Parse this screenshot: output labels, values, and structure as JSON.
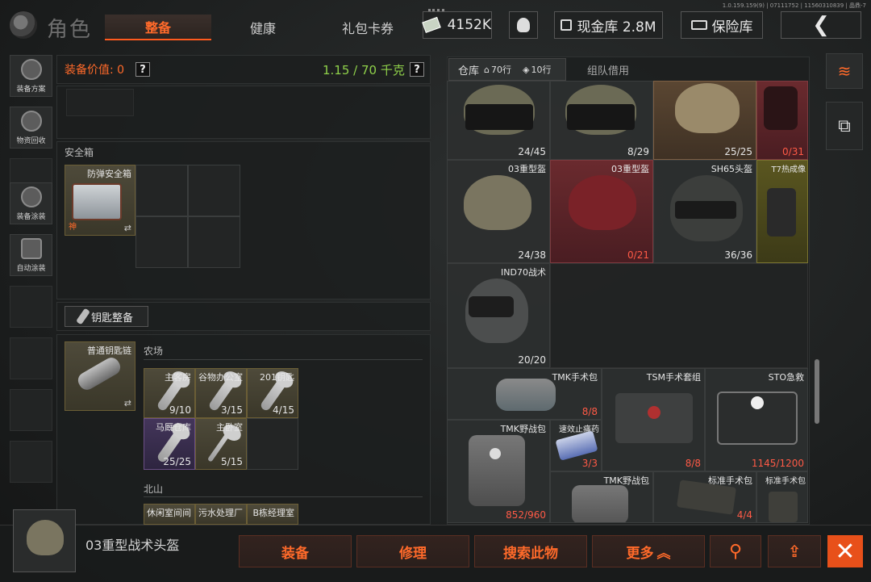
{
  "version": "1.0.159.159(9) | 07111752 | 11560310839 | 晶鼎-7",
  "header": {
    "section_title": "角色",
    "tabs": [
      "整备",
      "健康",
      "礼包卡券"
    ],
    "cash_value": "4152K",
    "vault_label": "现金库 2.8M",
    "safe_label": "保险库",
    "back_icon": "back-arrow-icon"
  },
  "left_toolbar": [
    {
      "label": "装备方案",
      "icon": "loadout-icon"
    },
    {
      "label": "物资回收",
      "icon": "recycle-icon"
    },
    {
      "label": "装备涂装",
      "icon": "paint-icon"
    },
    {
      "label": "自动涂装",
      "icon": "auto-paint-icon"
    }
  ],
  "loadout": {
    "value_label": "装备价值: 0",
    "help": "?",
    "weight": "1.15 / 70 千克",
    "safebox_title": "安全箱",
    "safebox_item": "防弹安全箱",
    "safebox_tag": "神",
    "keys_button": "钥匙整备",
    "keychain_item": "普通钥匙链",
    "groups": [
      {
        "name": "农场",
        "keys": [
          {
            "name": "主客房",
            "count": "9/10"
          },
          {
            "name": "谷物办公室",
            "count": "3/15"
          },
          {
            "name": "201钥匙",
            "count": "4/15"
          },
          {
            "name": "马厩仓库",
            "count": "25/25"
          },
          {
            "name": "主卧室",
            "count": "5/15"
          }
        ]
      },
      {
        "name": "北山",
        "keys": [
          {
            "name": "休闲室间间"
          },
          {
            "name": "污水处理厂"
          },
          {
            "name": "B栋经理室"
          }
        ]
      }
    ]
  },
  "inventory": {
    "tab_warehouse": "仓库",
    "rows_a": "70行",
    "rows_b": "10行",
    "tab_borrow": "组队借用",
    "items": [
      {
        "name": "",
        "count": "24/45"
      },
      {
        "name": "",
        "count": "8/29"
      },
      {
        "name": "",
        "count": "25/25"
      },
      {
        "name": "",
        "count": "0/31"
      },
      {
        "name": "03重型盔",
        "count": "24/38"
      },
      {
        "name": "03重型盔",
        "count": "0/21"
      },
      {
        "name": "SH65头盔",
        "count": "36/36"
      },
      {
        "name": "T7热成像",
        "count": ""
      },
      {
        "name": "IND70战术",
        "count": "20/20"
      },
      {
        "name": "TMK手术包",
        "count": "8/8"
      },
      {
        "name": "TSM手术套组",
        "count": "8/8"
      },
      {
        "name": "STO急救",
        "count": "1145/1200"
      },
      {
        "name": "TMK野战包",
        "count": "852/960"
      },
      {
        "name": "速效止痛药",
        "count": "3/3"
      },
      {
        "name": "TMK野战包",
        "count": ""
      },
      {
        "name": "标准手术包",
        "count": "4/4"
      },
      {
        "name": "标准手术包",
        "count": ""
      }
    ]
  },
  "bottom": {
    "selected_item": "03重型战术头盔",
    "actions": [
      "装备",
      "修理",
      "搜索此物",
      "更多"
    ],
    "more_icon": "chevron-up-icon"
  }
}
